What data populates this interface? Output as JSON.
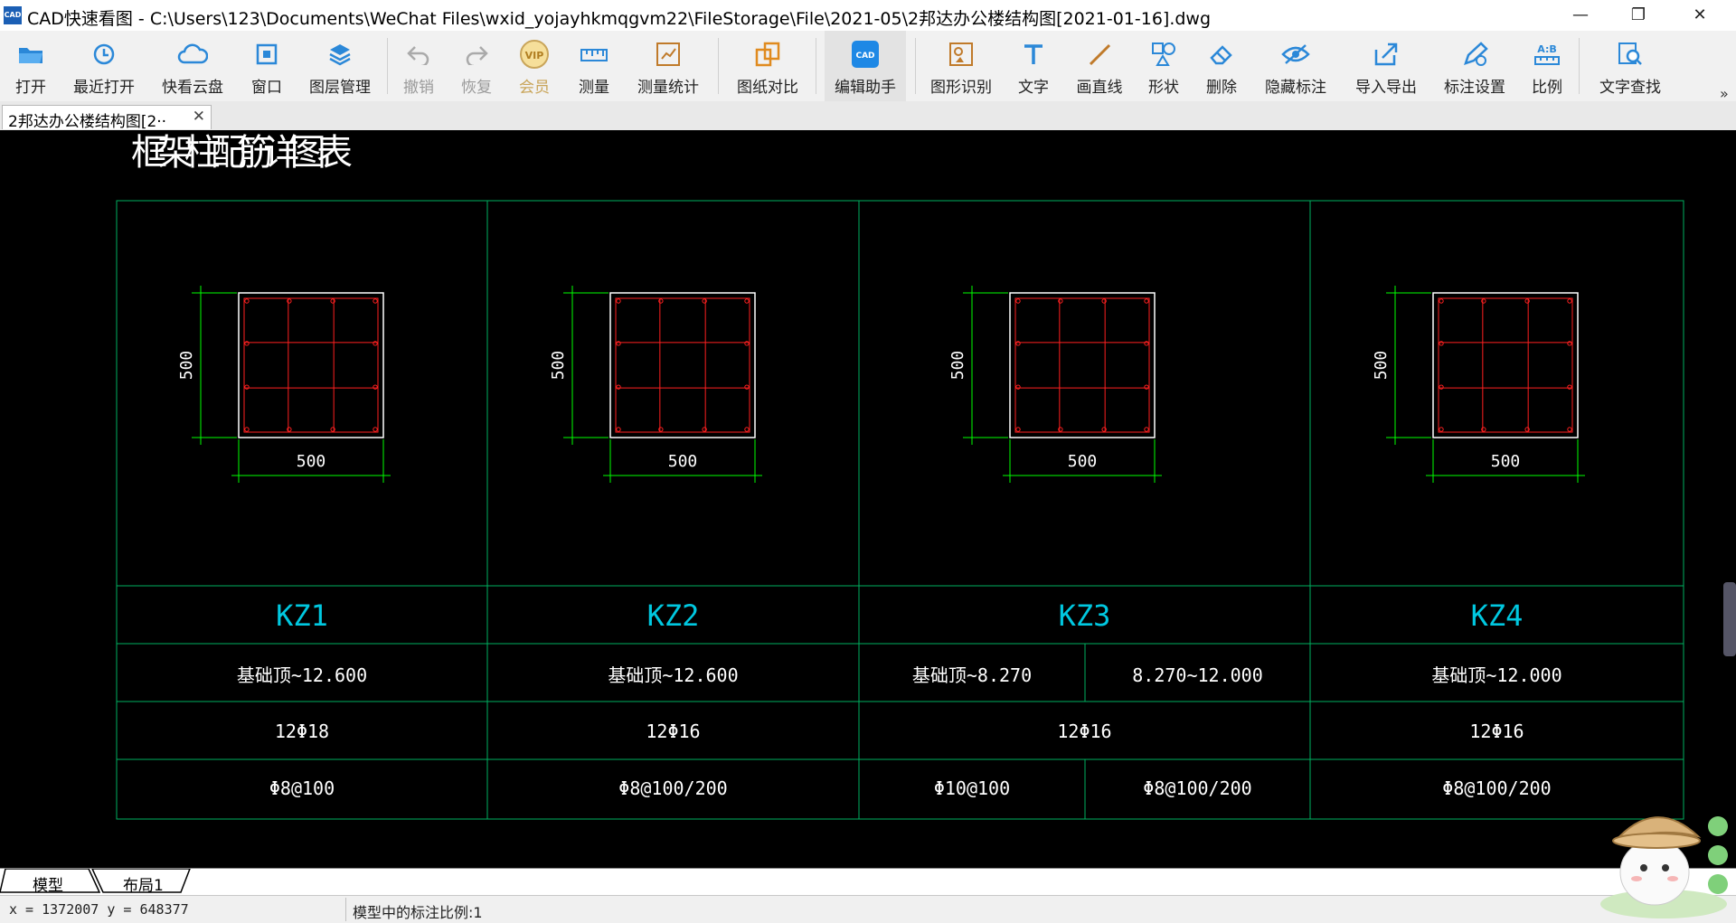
{
  "window": {
    "title": "CAD快速看图 - C:\\Users\\123\\Documents\\WeChat Files\\wxid_yojayhkmqgvm22\\FileStorage\\File\\2021-05\\2邦达办公楼结构图[2021-01-16].dwg",
    "logo_text": "CAD",
    "minimize": "—",
    "restore": "❐",
    "close": "✕"
  },
  "toolbar": {
    "items": [
      {
        "label": "打开",
        "icon": "folder-open-icon"
      },
      {
        "label": "最近打开",
        "icon": "history-icon"
      },
      {
        "label": "快看云盘",
        "icon": "cloud-icon"
      },
      {
        "label": "窗口",
        "icon": "window-icon"
      },
      {
        "label": "图层管理",
        "icon": "layers-icon"
      },
      {
        "label": "撤销",
        "icon": "undo-icon"
      },
      {
        "label": "恢复",
        "icon": "redo-icon"
      },
      {
        "label": "会员",
        "icon": "vip-icon",
        "badge": "VIP"
      },
      {
        "label": "测量",
        "icon": "ruler-icon"
      },
      {
        "label": "测量统计",
        "icon": "measure-stats-icon"
      },
      {
        "label": "图纸对比",
        "icon": "compare-icon"
      },
      {
        "label": "编辑助手",
        "icon": "edit-assistant-icon",
        "badge": "CAD"
      },
      {
        "label": "图形识别",
        "icon": "shape-recognize-icon"
      },
      {
        "label": "文字",
        "icon": "text-icon"
      },
      {
        "label": "画直线",
        "icon": "line-icon"
      },
      {
        "label": "形状",
        "icon": "shapes-icon"
      },
      {
        "label": "删除",
        "icon": "eraser-icon"
      },
      {
        "label": "隐藏标注",
        "icon": "hide-eye-icon"
      },
      {
        "label": "导入导出",
        "icon": "import-export-icon"
      },
      {
        "label": "标注设置",
        "icon": "annotation-settings-icon"
      },
      {
        "label": "比例",
        "icon": "scale-icon",
        "badge": "A:B"
      },
      {
        "label": "文字查找",
        "icon": "text-search-icon"
      }
    ],
    "more": "»"
  },
  "doc_tab": {
    "label": "2邦达办公楼结构图[2··",
    "close": "✕"
  },
  "drawing": {
    "title": "框架柱配筋详图表",
    "dimension_vertical": "500",
    "dimension_horizontal": "500",
    "columns": [
      {
        "name": "KZ1",
        "elevation": [
          "基础顶~12.600"
        ],
        "main_bars": "12Φ18",
        "stirrups": [
          "Φ8@100"
        ]
      },
      {
        "name": "KZ2",
        "elevation": [
          "基础顶~12.600"
        ],
        "main_bars": "12Φ16",
        "stirrups": [
          "Φ8@100/200"
        ]
      },
      {
        "name": "KZ3",
        "elevation": [
          "基础顶~8.270",
          "8.270~12.000"
        ],
        "main_bars": "12Φ16",
        "stirrups": [
          "Φ10@100",
          "Φ8@100/200"
        ]
      },
      {
        "name": "KZ4",
        "elevation": [
          "基础顶~12.000"
        ],
        "main_bars": "12Φ16",
        "stirrups": [
          "Φ8@100/200"
        ]
      }
    ],
    "colors": {
      "grid": "#00b060",
      "frame": "#ffffff",
      "rebar": "#ff2020",
      "dim": "#00ff00",
      "name": "#00c8e0",
      "text": "#ffffff"
    }
  },
  "layout_tabs": {
    "model": "模型",
    "layout1": "布局1"
  },
  "status": {
    "coords": "x = 1372007  y = 648377",
    "scale": "模型中的标注比例:1"
  }
}
